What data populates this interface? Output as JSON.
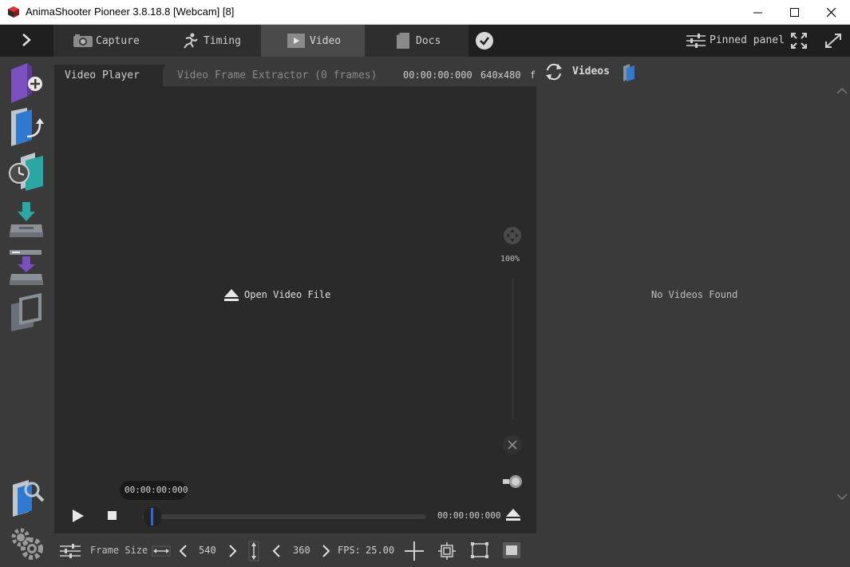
{
  "window": {
    "title": "AnimaShooter Pioneer 3.8.18.8 [Webcam] [8]"
  },
  "tabs": [
    {
      "label": "Capture",
      "icon": "camera-icon"
    },
    {
      "label": "Timing",
      "icon": "running-man-icon"
    },
    {
      "label": "Video",
      "icon": "play-icon",
      "active": true
    },
    {
      "label": "Docs",
      "icon": "document-icon"
    }
  ],
  "topbar": {
    "pinned_panel_label": "Pinned panel"
  },
  "player_tabs": {
    "video_player": "Video Player",
    "frame_extractor": "Video Frame Extractor (0 frames)",
    "timecode": "00:00:00:000",
    "resolution": "640x480",
    "fps_truncated": "f"
  },
  "player": {
    "open_file_label": "Open Video File",
    "zoom_label": "100%",
    "current_time_bubble": "00:00:00:000",
    "end_time": "00:00:00:000",
    "seek_progress": 0
  },
  "bottom": {
    "frame_size_label": "Frame Size",
    "width_value": "540",
    "height_value": "360",
    "fps_label": "FPS:",
    "fps_value": "25.00"
  },
  "right_panel": {
    "title": "Videos",
    "empty_message": "No Videos Found"
  },
  "colors": {
    "accent_seek": "#2f66d8",
    "active_tab": "#4a4a4a",
    "sidebar_purple": "#7a4fc0",
    "sidebar_teal": "#2aa7a3",
    "sidebar_blue": "#2f7ad0"
  }
}
